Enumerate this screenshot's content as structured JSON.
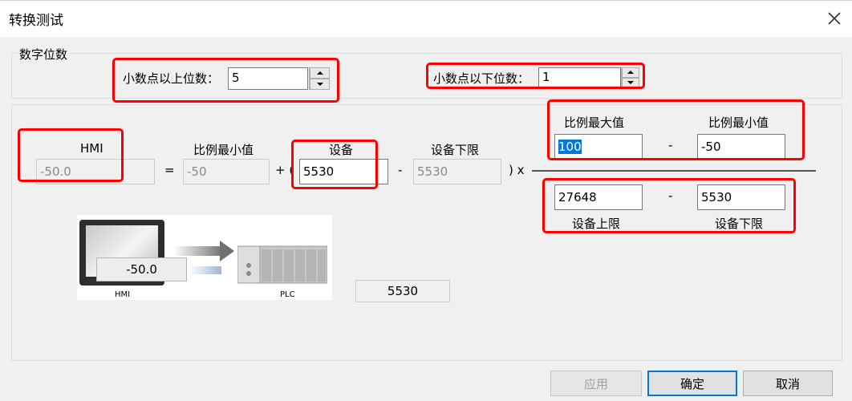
{
  "window": {
    "title": "转换测试"
  },
  "digits_group": {
    "title": "数字位数",
    "upper_label": "小数点以上位数：",
    "upper_value": "5",
    "lower_label": "小数点以下位数：",
    "lower_value": "1"
  },
  "formula": {
    "hmi_label": "HMI",
    "hmi_value": "-50.0",
    "equals": "=",
    "scale_min_label": "比例最小值",
    "scale_min_value": "-50",
    "plus_paren": "+ (",
    "device_label": "设备",
    "device_value": "5530",
    "minus1": "-",
    "device_lower_label": "设备下限",
    "device_lower_value": "5530",
    "close_times": ") x",
    "numerator": {
      "max_label": "比例最大值",
      "max_value": "100",
      "minus": "-",
      "min_label": "比例最小值",
      "min_value": "-50"
    },
    "denominator": {
      "upper_value": "27648",
      "minus": "-",
      "lower_value": "5530",
      "upper_label": "设备上限",
      "lower_label": "设备下限"
    }
  },
  "diagram": {
    "hmi_display_value": "-50.0",
    "hmi_caption": "HMI",
    "plc_caption": "PLC",
    "plc_value": "5530"
  },
  "buttons": {
    "apply": "应用",
    "ok": "确定",
    "cancel": "取消"
  },
  "colors": {
    "highlight": "#ff0000",
    "selection": "#0078d7",
    "window_bg": "#f0f0f0"
  }
}
